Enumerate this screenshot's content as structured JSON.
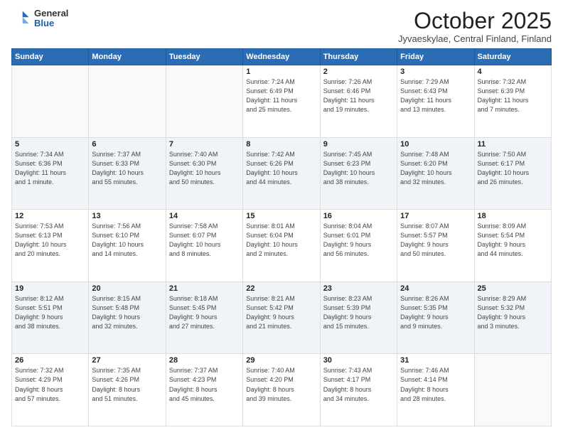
{
  "header": {
    "logo_general": "General",
    "logo_blue": "Blue",
    "title": "October 2025",
    "location": "Jyvaeskylae, Central Finland, Finland"
  },
  "weekdays": [
    "Sunday",
    "Monday",
    "Tuesday",
    "Wednesday",
    "Thursday",
    "Friday",
    "Saturday"
  ],
  "weeks": [
    [
      {
        "day": "",
        "info": ""
      },
      {
        "day": "",
        "info": ""
      },
      {
        "day": "",
        "info": ""
      },
      {
        "day": "1",
        "info": "Sunrise: 7:24 AM\nSunset: 6:49 PM\nDaylight: 11 hours\nand 25 minutes."
      },
      {
        "day": "2",
        "info": "Sunrise: 7:26 AM\nSunset: 6:46 PM\nDaylight: 11 hours\nand 19 minutes."
      },
      {
        "day": "3",
        "info": "Sunrise: 7:29 AM\nSunset: 6:43 PM\nDaylight: 11 hours\nand 13 minutes."
      },
      {
        "day": "4",
        "info": "Sunrise: 7:32 AM\nSunset: 6:39 PM\nDaylight: 11 hours\nand 7 minutes."
      }
    ],
    [
      {
        "day": "5",
        "info": "Sunrise: 7:34 AM\nSunset: 6:36 PM\nDaylight: 11 hours\nand 1 minute."
      },
      {
        "day": "6",
        "info": "Sunrise: 7:37 AM\nSunset: 6:33 PM\nDaylight: 10 hours\nand 55 minutes."
      },
      {
        "day": "7",
        "info": "Sunrise: 7:40 AM\nSunset: 6:30 PM\nDaylight: 10 hours\nand 50 minutes."
      },
      {
        "day": "8",
        "info": "Sunrise: 7:42 AM\nSunset: 6:26 PM\nDaylight: 10 hours\nand 44 minutes."
      },
      {
        "day": "9",
        "info": "Sunrise: 7:45 AM\nSunset: 6:23 PM\nDaylight: 10 hours\nand 38 minutes."
      },
      {
        "day": "10",
        "info": "Sunrise: 7:48 AM\nSunset: 6:20 PM\nDaylight: 10 hours\nand 32 minutes."
      },
      {
        "day": "11",
        "info": "Sunrise: 7:50 AM\nSunset: 6:17 PM\nDaylight: 10 hours\nand 26 minutes."
      }
    ],
    [
      {
        "day": "12",
        "info": "Sunrise: 7:53 AM\nSunset: 6:13 PM\nDaylight: 10 hours\nand 20 minutes."
      },
      {
        "day": "13",
        "info": "Sunrise: 7:56 AM\nSunset: 6:10 PM\nDaylight: 10 hours\nand 14 minutes."
      },
      {
        "day": "14",
        "info": "Sunrise: 7:58 AM\nSunset: 6:07 PM\nDaylight: 10 hours\nand 8 minutes."
      },
      {
        "day": "15",
        "info": "Sunrise: 8:01 AM\nSunset: 6:04 PM\nDaylight: 10 hours\nand 2 minutes."
      },
      {
        "day": "16",
        "info": "Sunrise: 8:04 AM\nSunset: 6:01 PM\nDaylight: 9 hours\nand 56 minutes."
      },
      {
        "day": "17",
        "info": "Sunrise: 8:07 AM\nSunset: 5:57 PM\nDaylight: 9 hours\nand 50 minutes."
      },
      {
        "day": "18",
        "info": "Sunrise: 8:09 AM\nSunset: 5:54 PM\nDaylight: 9 hours\nand 44 minutes."
      }
    ],
    [
      {
        "day": "19",
        "info": "Sunrise: 8:12 AM\nSunset: 5:51 PM\nDaylight: 9 hours\nand 38 minutes."
      },
      {
        "day": "20",
        "info": "Sunrise: 8:15 AM\nSunset: 5:48 PM\nDaylight: 9 hours\nand 32 minutes."
      },
      {
        "day": "21",
        "info": "Sunrise: 8:18 AM\nSunset: 5:45 PM\nDaylight: 9 hours\nand 27 minutes."
      },
      {
        "day": "22",
        "info": "Sunrise: 8:21 AM\nSunset: 5:42 PM\nDaylight: 9 hours\nand 21 minutes."
      },
      {
        "day": "23",
        "info": "Sunrise: 8:23 AM\nSunset: 5:39 PM\nDaylight: 9 hours\nand 15 minutes."
      },
      {
        "day": "24",
        "info": "Sunrise: 8:26 AM\nSunset: 5:35 PM\nDaylight: 9 hours\nand 9 minutes."
      },
      {
        "day": "25",
        "info": "Sunrise: 8:29 AM\nSunset: 5:32 PM\nDaylight: 9 hours\nand 3 minutes."
      }
    ],
    [
      {
        "day": "26",
        "info": "Sunrise: 7:32 AM\nSunset: 4:29 PM\nDaylight: 8 hours\nand 57 minutes."
      },
      {
        "day": "27",
        "info": "Sunrise: 7:35 AM\nSunset: 4:26 PM\nDaylight: 8 hours\nand 51 minutes."
      },
      {
        "day": "28",
        "info": "Sunrise: 7:37 AM\nSunset: 4:23 PM\nDaylight: 8 hours\nand 45 minutes."
      },
      {
        "day": "29",
        "info": "Sunrise: 7:40 AM\nSunset: 4:20 PM\nDaylight: 8 hours\nand 39 minutes."
      },
      {
        "day": "30",
        "info": "Sunrise: 7:43 AM\nSunset: 4:17 PM\nDaylight: 8 hours\nand 34 minutes."
      },
      {
        "day": "31",
        "info": "Sunrise: 7:46 AM\nSunset: 4:14 PM\nDaylight: 8 hours\nand 28 minutes."
      },
      {
        "day": "",
        "info": ""
      }
    ]
  ]
}
